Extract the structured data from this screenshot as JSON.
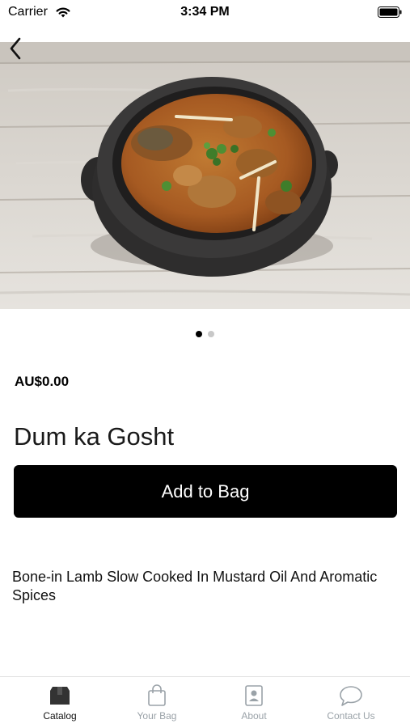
{
  "status_bar": {
    "carrier": "Carrier",
    "time": "3:34 PM"
  },
  "product": {
    "price": "AU$0.00",
    "name": "Dum ka Gosht",
    "description": "Bone-in Lamb Slow Cooked In Mustard Oil And Aromatic Spices",
    "image_pages": 2,
    "current_page": 1
  },
  "actions": {
    "add_to_bag_label": "Add to Bag"
  },
  "tab_bar": {
    "tabs": [
      {
        "label": "Catalog",
        "icon": "box-icon",
        "active": true
      },
      {
        "label": "Your Bag",
        "icon": "shopping-bag-icon",
        "active": false
      },
      {
        "label": "About",
        "icon": "contact-card-icon",
        "active": false
      },
      {
        "label": "Contact Us",
        "icon": "chat-bubble-icon",
        "active": false
      }
    ]
  },
  "colors": {
    "primary_button": "#000000",
    "tab_active": "#111111",
    "tab_inactive": "#9aa2a8"
  }
}
